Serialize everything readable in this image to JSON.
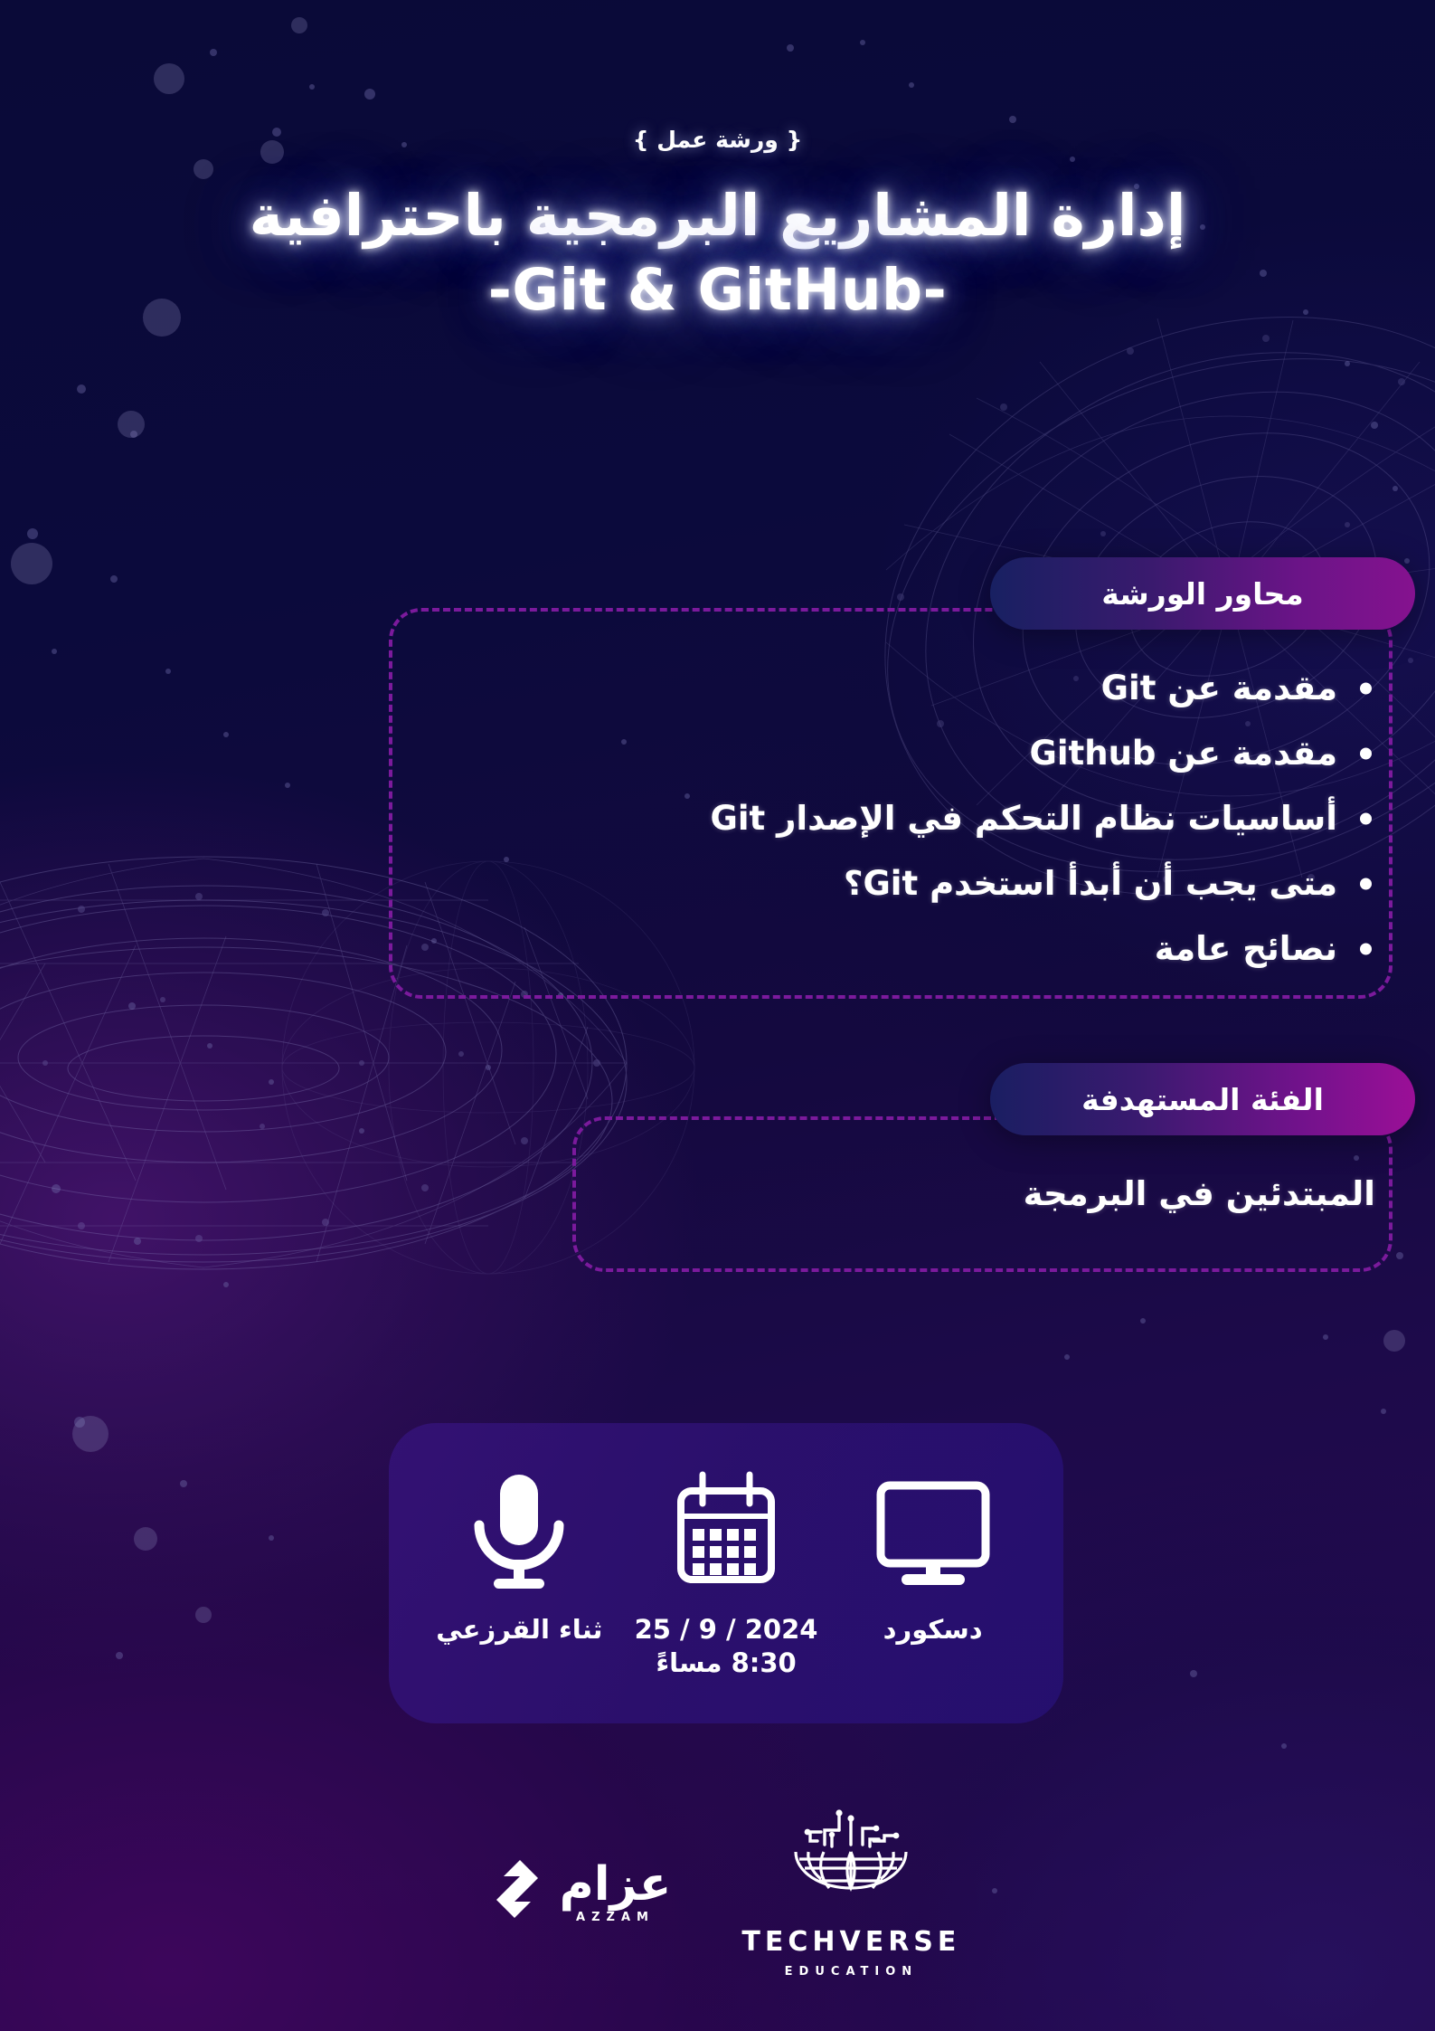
{
  "header": {
    "kicker": "{ ورشة عمل }",
    "title": "إدارة المشاريع البرمجية باحترافية",
    "subtitle_latin": "-Git & GitHub-"
  },
  "topics": {
    "badge_label": "محاور الورشة",
    "items": [
      "مقدمة عن Git",
      "مقدمة عن Github",
      "أساسيات نظام التحكم في الإصدار Git",
      "متى يجب أن أبدأ استخدم Git؟",
      "نصائح عامة"
    ]
  },
  "audience": {
    "badge_label": "الفئة المستهدفة",
    "value": "المبتدئين في البرمجة"
  },
  "info": {
    "speaker": {
      "icon": "microphone-icon",
      "label": "ثناء القرزعي"
    },
    "date": {
      "icon": "calendar-icon",
      "label": "2024 / 9 / 25",
      "time": "8:30 مساءً"
    },
    "platform": {
      "icon": "monitor-icon",
      "label": "دسكورد"
    }
  },
  "footer": {
    "azzam": {
      "wordmark": "عزام",
      "latin": "AZZAM"
    },
    "techverse": {
      "name": "TECHVERSE",
      "tagline": "EDUCATION"
    }
  },
  "colors": {
    "bg_navy": "#0a0a38",
    "bg_purple": "#2c0755",
    "accent_magenta": "#85128f",
    "dashed_border": "#7b1a9c",
    "panel_violet": "#341276",
    "text_white": "#ffffff"
  }
}
